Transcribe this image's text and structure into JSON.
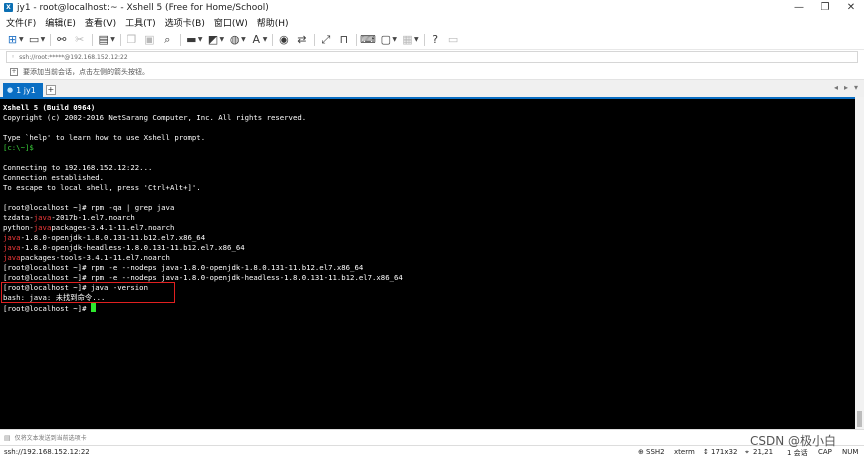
{
  "window": {
    "title": "jy1 - root@localhost:~ - Xshell 5 (Free for Home/School)",
    "app_icon_letter": "X",
    "minimize": "—",
    "maximize": "❐",
    "close": "✕"
  },
  "menu": [
    "文件(F)",
    "编辑(E)",
    "查看(V)",
    "工具(T)",
    "选项卡(B)",
    "窗口(W)",
    "帮助(H)"
  ],
  "address": {
    "value": "ssh://root:*****@192.168.152.12:22"
  },
  "hint": {
    "text": "要添加当前会话，点击左侧的箭头按钮。"
  },
  "tabs": {
    "active_label": "1 jy1",
    "add_label": "+",
    "prev": "◂",
    "next": "▸",
    "menu": "▾"
  },
  "terminal": {
    "l01": "Xshell 5 (Build 0964)",
    "l02": "Copyright (c) 2002-2016 NetSarang Computer, Inc. All rights reserved.",
    "l04": "Type `help' to learn how to use Xshell prompt.",
    "l05": "[c:\\~]$",
    "l07": "Connecting to 192.168.152.12:22...",
    "l08": "Connection established.",
    "l09": "To escape to local shell, press 'Ctrl+Alt+]'.",
    "l11": "[root@localhost ~]# rpm -qa | grep java",
    "l12a": "tzdata-",
    "java": "java",
    "l12b": "-2017b-1.el7.noarch",
    "l13a": "python-",
    "l13b": "packages-3.4.1-11.el7.noarch",
    "l14b": "-1.8.0-openjdk-1.8.0.131-11.b12.el7.x86_64",
    "l15b": "-1.8.0-openjdk-headless-1.8.0.131-11.b12.el7.x86_64",
    "l16b": "packages-tools-3.4.1-11.el7.noarch",
    "l17": "[root@localhost ~]# rpm -e --nodeps java-1.8.0-openjdk-1.8.0.131-11.b12.el7.x86_64",
    "l18": "[root@localhost ~]# rpm -e --nodeps java-1.8.0-openjdk-headless-1.8.0.131-11.b12.el7.x86_64",
    "l19": "[root@localhost ~]# java -version",
    "l20": "bash: java: 未找到命令...",
    "l21": "[root@localhost ~]# "
  },
  "send": {
    "text": "仅将文本发送到当前选项卡"
  },
  "status": {
    "connection": "ssh://192.168.152.12:22",
    "protocol": "SSH2",
    "term": "xterm",
    "size": "171x32",
    "position": "21,21",
    "sessions": "1 会话",
    "caps": "CAP",
    "num": "NUM"
  },
  "watermark": "CSDN @极小白"
}
